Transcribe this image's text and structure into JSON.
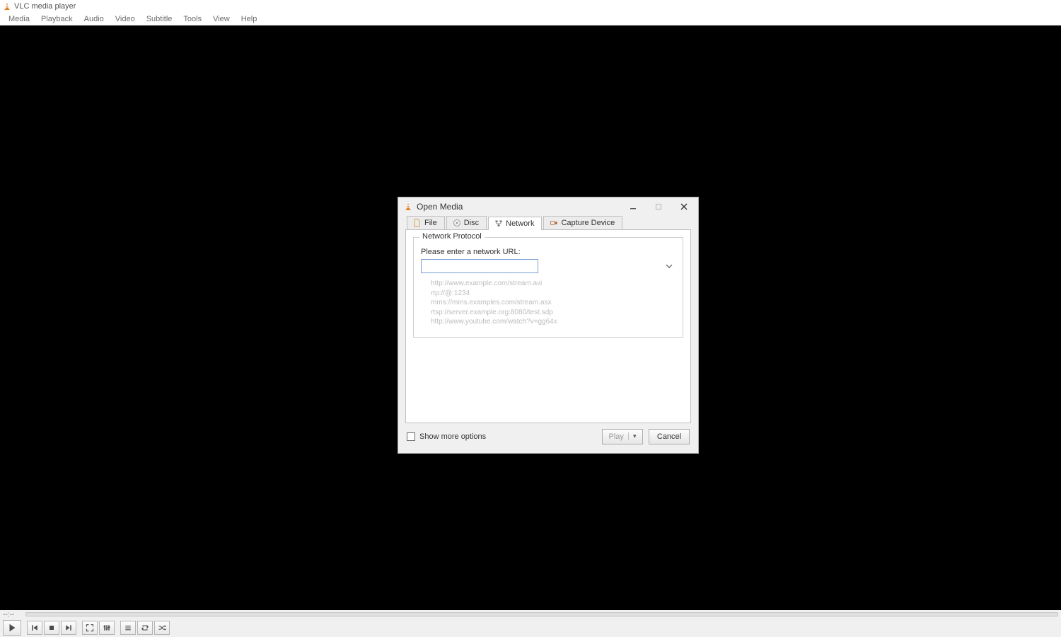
{
  "titlebar": {
    "app_title": "VLC media player"
  },
  "menubar": {
    "items": [
      "Media",
      "Playback",
      "Audio",
      "Video",
      "Subtitle",
      "Tools",
      "View",
      "Help"
    ]
  },
  "seek": {
    "time_elapsed": "--:--"
  },
  "controls": {
    "play": "Play",
    "prev": "Previous",
    "stop": "Stop",
    "next": "Next",
    "fullscreen": "Fullscreen",
    "ext_settings": "Extended settings",
    "playlist": "Playlist",
    "loop": "Loop",
    "shuffle": "Shuffle"
  },
  "dialog": {
    "title": "Open Media",
    "tabs": {
      "file": "File",
      "disc": "Disc",
      "network": "Network",
      "capture": "Capture Device"
    },
    "network": {
      "group_title": "Network Protocol",
      "url_label": "Please enter a network URL:",
      "url_value": "",
      "examples": "http://www.example.com/stream.avi\nrtp://@:1234\nmms://mms.examples.com/stream.asx\nrtsp://server.example.org:8080/test.sdp\nhttp://www.youtube.com/watch?v=gg64x"
    },
    "show_more": "Show more options",
    "play_btn": "Play",
    "cancel_btn": "Cancel"
  }
}
